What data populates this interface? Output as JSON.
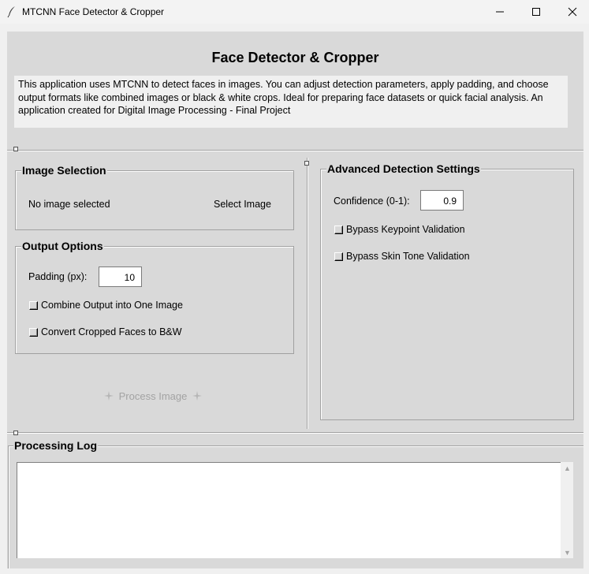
{
  "window": {
    "title": "MTCNN Face Detector & Cropper"
  },
  "header": {
    "title": "Face Detector & Cropper",
    "description": "This application uses MTCNN to detect faces in images. You can adjust detection parameters, apply padding, and choose output formats like combined images or black & white crops. Ideal for preparing face datasets or quick facial analysis. An application created for Digital Image Processing - Final Project"
  },
  "image_selection": {
    "label": "Image Selection",
    "status": "No image selected",
    "select_button": "Select Image"
  },
  "output_options": {
    "label": "Output Options",
    "padding_label": "Padding (px):",
    "padding_value": "10",
    "combine_label": "Combine Output into One Image",
    "combine_checked": false,
    "bw_label": "Convert Cropped Faces to B&W",
    "bw_checked": false
  },
  "process_button": {
    "label": "Process Image",
    "enabled": false
  },
  "advanced": {
    "label": "Advanced Detection Settings",
    "confidence_label": "Confidence (0-1):",
    "confidence_value": "0.9",
    "bypass_keypoint_label": "Bypass Keypoint Validation",
    "bypass_keypoint_checked": false,
    "bypass_skin_label": "Bypass Skin Tone Validation",
    "bypass_skin_checked": false
  },
  "log": {
    "label": "Processing Log",
    "content": ""
  }
}
